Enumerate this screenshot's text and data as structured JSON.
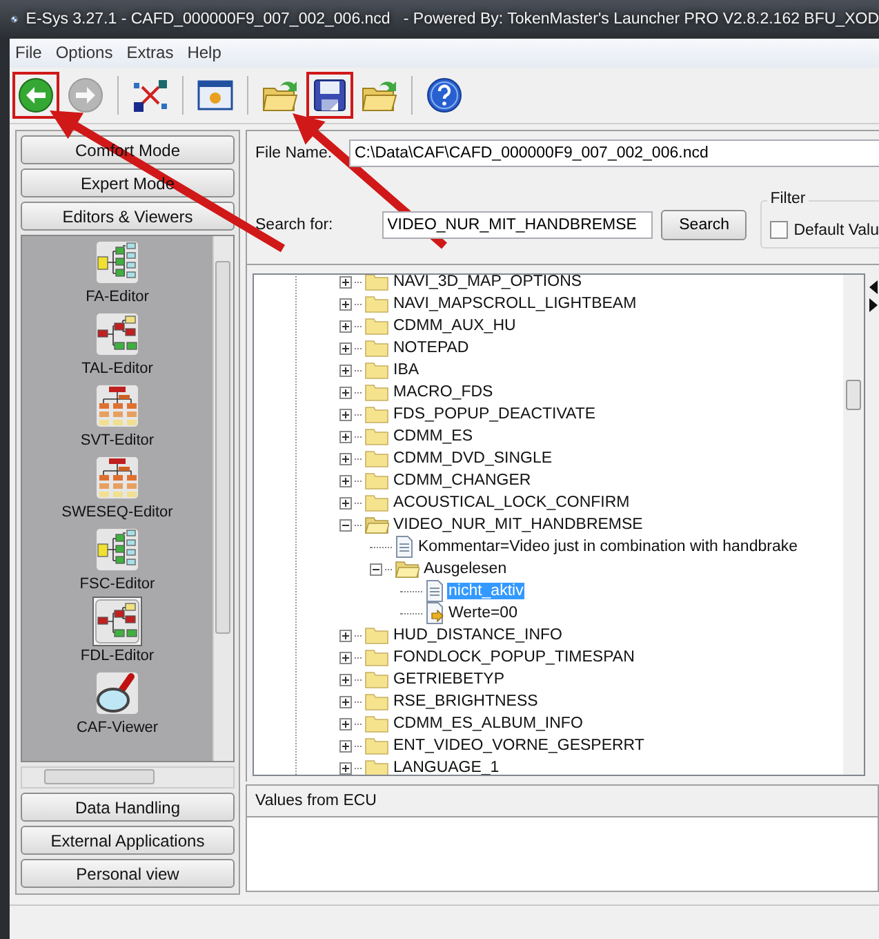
{
  "window": {
    "title": "E-Sys 3.27.1 - CAFD_000000F9_007_002_006.ncd   - Powered By: TokenMaster's Launcher PRO V2.8.2.162 BFU_XOD"
  },
  "menu": [
    "File",
    "Options",
    "Extras",
    "Help"
  ],
  "toolbar": [
    {
      "kind": "back",
      "disabled": false,
      "highlighted": true
    },
    {
      "kind": "forward",
      "disabled": true,
      "highlighted": false
    },
    {
      "kind": "separator"
    },
    {
      "kind": "network",
      "disabled": false,
      "highlighted": false
    },
    {
      "kind": "separator"
    },
    {
      "kind": "window",
      "disabled": false,
      "highlighted": false
    },
    {
      "kind": "separator"
    },
    {
      "kind": "open",
      "disabled": false,
      "highlighted": false
    },
    {
      "kind": "save",
      "disabled": false,
      "highlighted": true
    },
    {
      "kind": "open",
      "disabled": false,
      "highlighted": false
    },
    {
      "kind": "separator"
    },
    {
      "kind": "help",
      "disabled": false,
      "highlighted": false
    }
  ],
  "sidebar": {
    "top_sections": [
      "Comfort Mode",
      "Expert Mode",
      "Editors & Viewers"
    ],
    "tools": [
      {
        "label": "FA-Editor",
        "kind": "hierarchy",
        "selected": false
      },
      {
        "label": "TAL-Editor",
        "kind": "branch",
        "selected": false
      },
      {
        "label": "SVT-Editor",
        "kind": "orgchart",
        "selected": false
      },
      {
        "label": "SWESEQ-Editor",
        "kind": "orgchart",
        "selected": false
      },
      {
        "label": "FSC-Editor",
        "kind": "hierarchy",
        "selected": false
      },
      {
        "label": "FDL-Editor",
        "kind": "branch",
        "selected": true
      },
      {
        "label": "CAF-Viewer",
        "kind": "magnifier",
        "selected": false
      }
    ],
    "bottom_sections": [
      "Data Handling",
      "External Applications",
      "Personal view"
    ]
  },
  "file_name": {
    "label": "File Name:",
    "value": "C:\\Data\\CAF\\CAFD_000000F9_007_002_006.ncd"
  },
  "search": {
    "label": "Search for:",
    "value": "VIDEO_NUR_MIT_HANDBREMSE",
    "button": "Search"
  },
  "filter": {
    "title": "Filter",
    "options": [
      {
        "label": "Default Valu",
        "checked": false
      }
    ]
  },
  "tree": [
    {
      "label": "NAVI_3D_MAP_OPTIONS",
      "kind": "folder",
      "expanded": false,
      "selected": false
    },
    {
      "label": "NAVI_MAPSCROLL_LIGHTBEAM",
      "kind": "folder",
      "expanded": false,
      "selected": false
    },
    {
      "label": "CDMM_AUX_HU",
      "kind": "folder",
      "expanded": false,
      "selected": false
    },
    {
      "label": "NOTEPAD",
      "kind": "folder",
      "expanded": false,
      "selected": false
    },
    {
      "label": "IBA",
      "kind": "folder",
      "expanded": false,
      "selected": false
    },
    {
      "label": "MACRO_FDS",
      "kind": "folder",
      "expanded": false,
      "selected": false
    },
    {
      "label": "FDS_POPUP_DEACTIVATE",
      "kind": "folder",
      "expanded": false,
      "selected": false
    },
    {
      "label": "CDMM_ES",
      "kind": "folder",
      "expanded": false,
      "selected": false
    },
    {
      "label": "CDMM_DVD_SINGLE",
      "kind": "folder",
      "expanded": false,
      "selected": false
    },
    {
      "label": "CDMM_CHANGER",
      "kind": "folder",
      "expanded": false,
      "selected": false
    },
    {
      "label": "ACOUSTICAL_LOCK_CONFIRM",
      "kind": "folder",
      "expanded": false,
      "selected": false
    },
    {
      "label": "VIDEO_NUR_MIT_HANDBREMSE",
      "kind": "folder",
      "expanded": true,
      "selected": false,
      "children": [
        {
          "label": "Kommentar=Video just in combination with handbrake",
          "kind": "document",
          "selected": false
        },
        {
          "label": "Ausgelesen",
          "kind": "folder",
          "expanded": true,
          "selected": false,
          "children": [
            {
              "label": "nicht_aktiv",
              "kind": "document",
              "selected": true
            },
            {
              "label": "Werte=00",
              "kind": "value",
              "selected": false
            }
          ]
        }
      ]
    },
    {
      "label": "HUD_DISTANCE_INFO",
      "kind": "folder",
      "expanded": false,
      "selected": false
    },
    {
      "label": "FONDLOCK_POPUP_TIMESPAN",
      "kind": "folder",
      "expanded": false,
      "selected": false
    },
    {
      "label": "GETRIEBETYP",
      "kind": "folder",
      "expanded": false,
      "selected": false
    },
    {
      "label": "RSE_BRIGHTNESS",
      "kind": "folder",
      "expanded": false,
      "selected": false
    },
    {
      "label": "CDMM_ES_ALBUM_INFO",
      "kind": "folder",
      "expanded": false,
      "selected": false
    },
    {
      "label": "ENT_VIDEO_VORNE_GESPERRT",
      "kind": "folder",
      "expanded": false,
      "selected": false
    },
    {
      "label": "LANGUAGE_1",
      "kind": "folder",
      "expanded": false,
      "selected": false
    }
  ],
  "values_panel": {
    "title": "Values from ECU"
  }
}
